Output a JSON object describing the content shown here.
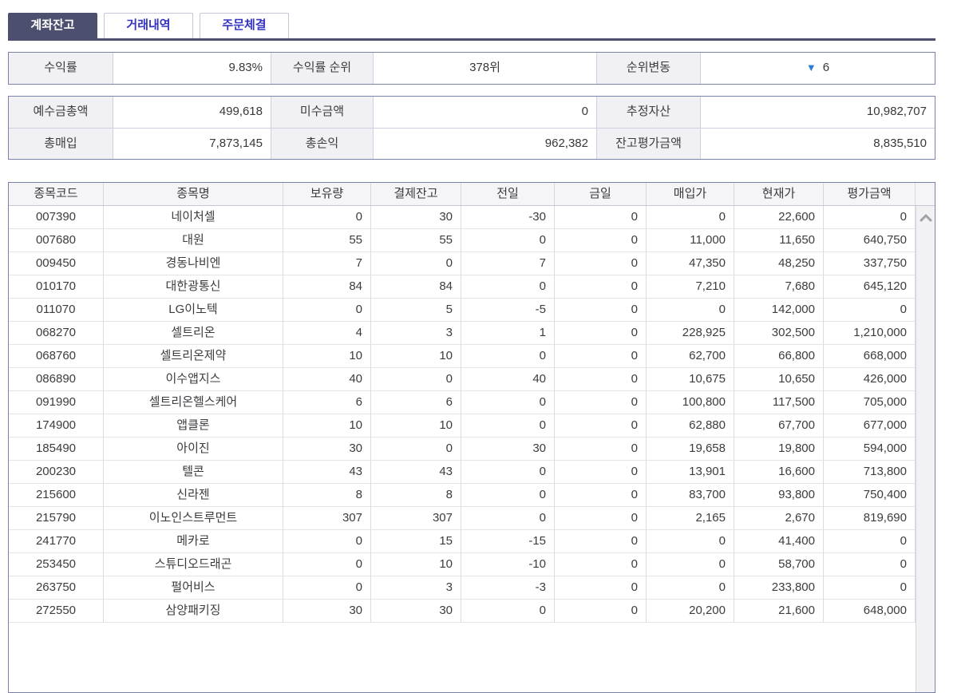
{
  "colors": {
    "active_tab_bg": "#4c506e",
    "tab_text_blue": "#3434c0",
    "box_border": "#7d82ab",
    "label_cell_bg": "#f1f1f5",
    "down_triangle_blue": "#2b7bd6"
  },
  "tabs": {
    "items": [
      {
        "label": "계좌잔고",
        "active": true
      },
      {
        "label": "거래내역",
        "active": false
      },
      {
        "label": "주문체결",
        "active": false
      }
    ]
  },
  "rank_summary": {
    "cells": [
      {
        "label": "수익률",
        "value": "9.83%"
      },
      {
        "label": "수익률 순위",
        "value": "378위"
      },
      {
        "label": "순위변동",
        "value": "6",
        "direction_icon": "▼"
      }
    ]
  },
  "account_summary": {
    "rows": [
      [
        {
          "label": "예수금총액",
          "value": "499,618"
        },
        {
          "label": "미수금액",
          "value": "0"
        },
        {
          "label": "추정자산",
          "value": "10,982,707"
        }
      ],
      [
        {
          "label": "총매입",
          "value": "7,873,145"
        },
        {
          "label": "총손익",
          "value": "962,382"
        },
        {
          "label": "잔고평가금액",
          "value": "8,835,510"
        }
      ]
    ]
  },
  "table": {
    "columns": [
      "종목코드",
      "종목명",
      "보유량",
      "결제잔고",
      "전일",
      "금일",
      "매입가",
      "현재가",
      "평가금액"
    ],
    "rows": [
      {
        "code": "007390",
        "name": "네이처셀",
        "qty": "0",
        "settle": "30",
        "prev": "-30",
        "today": "0",
        "buy": "0",
        "cur": "22,600",
        "eval": "0"
      },
      {
        "code": "007680",
        "name": "대원",
        "qty": "55",
        "settle": "55",
        "prev": "0",
        "today": "0",
        "buy": "11,000",
        "cur": "11,650",
        "eval": "640,750"
      },
      {
        "code": "009450",
        "name": "경동나비엔",
        "qty": "7",
        "settle": "0",
        "prev": "7",
        "today": "0",
        "buy": "47,350",
        "cur": "48,250",
        "eval": "337,750"
      },
      {
        "code": "010170",
        "name": "대한광통신",
        "qty": "84",
        "settle": "84",
        "prev": "0",
        "today": "0",
        "buy": "7,210",
        "cur": "7,680",
        "eval": "645,120"
      },
      {
        "code": "011070",
        "name": "LG이노텍",
        "qty": "0",
        "settle": "5",
        "prev": "-5",
        "today": "0",
        "buy": "0",
        "cur": "142,000",
        "eval": "0"
      },
      {
        "code": "068270",
        "name": "셀트리온",
        "qty": "4",
        "settle": "3",
        "prev": "1",
        "today": "0",
        "buy": "228,925",
        "cur": "302,500",
        "eval": "1,210,000"
      },
      {
        "code": "068760",
        "name": "셀트리온제약",
        "qty": "10",
        "settle": "10",
        "prev": "0",
        "today": "0",
        "buy": "62,700",
        "cur": "66,800",
        "eval": "668,000"
      },
      {
        "code": "086890",
        "name": "이수앱지스",
        "qty": "40",
        "settle": "0",
        "prev": "40",
        "today": "0",
        "buy": "10,675",
        "cur": "10,650",
        "eval": "426,000"
      },
      {
        "code": "091990",
        "name": "셀트리온헬스케어",
        "qty": "6",
        "settle": "6",
        "prev": "0",
        "today": "0",
        "buy": "100,800",
        "cur": "117,500",
        "eval": "705,000"
      },
      {
        "code": "174900",
        "name": "앱클론",
        "qty": "10",
        "settle": "10",
        "prev": "0",
        "today": "0",
        "buy": "62,880",
        "cur": "67,700",
        "eval": "677,000"
      },
      {
        "code": "185490",
        "name": "아이진",
        "qty": "30",
        "settle": "0",
        "prev": "30",
        "today": "0",
        "buy": "19,658",
        "cur": "19,800",
        "eval": "594,000"
      },
      {
        "code": "200230",
        "name": "텔콘",
        "qty": "43",
        "settle": "43",
        "prev": "0",
        "today": "0",
        "buy": "13,901",
        "cur": "16,600",
        "eval": "713,800"
      },
      {
        "code": "215600",
        "name": "신라젠",
        "qty": "8",
        "settle": "8",
        "prev": "0",
        "today": "0",
        "buy": "83,700",
        "cur": "93,800",
        "eval": "750,400"
      },
      {
        "code": "215790",
        "name": "이노인스트루먼트",
        "qty": "307",
        "settle": "307",
        "prev": "0",
        "today": "0",
        "buy": "2,165",
        "cur": "2,670",
        "eval": "819,690"
      },
      {
        "code": "241770",
        "name": "메카로",
        "qty": "0",
        "settle": "15",
        "prev": "-15",
        "today": "0",
        "buy": "0",
        "cur": "41,400",
        "eval": "0"
      },
      {
        "code": "253450",
        "name": "스튜디오드래곤",
        "qty": "0",
        "settle": "10",
        "prev": "-10",
        "today": "0",
        "buy": "0",
        "cur": "58,700",
        "eval": "0"
      },
      {
        "code": "263750",
        "name": "펄어비스",
        "qty": "0",
        "settle": "3",
        "prev": "-3",
        "today": "0",
        "buy": "0",
        "cur": "233,800",
        "eval": "0"
      },
      {
        "code": "272550",
        "name": "삼양패키징",
        "qty": "30",
        "settle": "30",
        "prev": "0",
        "today": "0",
        "buy": "20,200",
        "cur": "21,600",
        "eval": "648,000"
      }
    ]
  }
}
